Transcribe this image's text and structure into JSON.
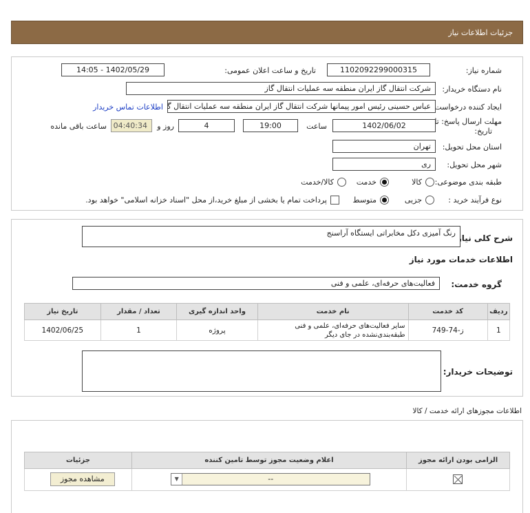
{
  "header": {
    "title": "جزئیات اطلاعات نیاز"
  },
  "form": {
    "need_number_label": "شماره نیاز:",
    "need_number": "1102092299000315",
    "announce_label": "تاریخ و ساعت اعلان عمومی:",
    "announce_value": "1402/05/29 - 14:05",
    "buyer_org_label": "نام دستگاه خریدار:",
    "buyer_org": "شرکت انتقال گاز ایران منطقه سه عملیات انتقال گاز",
    "requester_label": "ایجاد کننده درخواست:",
    "requester": "عباس حسینی رئیس امور پیمانها شرکت انتقال گاز ایران منطقه سه عملیات انتقال گاز",
    "contact_link": "اطلاعات تماس خریدار",
    "deadline_label_1": "مهلت ارسال پاسخ: تا",
    "deadline_label_2": "تاریخ:",
    "deadline_date": "1402/06/02",
    "time_label": "ساعت",
    "deadline_time": "19:00",
    "days_value": "4",
    "days_label": "روز و",
    "remaining_time": "04:40:34",
    "remaining_label": "ساعت باقی مانده",
    "province_label": "استان محل تحویل:",
    "province": "تهران",
    "city_label": "شهر محل تحویل:",
    "city": "ری",
    "category_label": "طبقه بندی موضوعی:",
    "category_options": [
      "کالا",
      "خدمت",
      "کالا/خدمت"
    ],
    "category_selected": "خدمت",
    "process_label": "نوع فرآیند خرید :",
    "process_options": [
      "جزیی",
      "متوسط"
    ],
    "process_selected": "متوسط",
    "payment_note": "پرداخت تمام یا بخشی از مبلغ خرید،از محل \"اسناد خزانه اسلامی\" خواهد بود."
  },
  "summary": {
    "label": "شرح کلی نیاز:",
    "value": "رنگ آمیزی دکل مخابراتی ایستگاه آراسنج"
  },
  "services": {
    "title": "اطلاعات خدمات مورد نیاز",
    "group_label": "گروه خدمت:",
    "group_value": "فعالیت‌های حرفه‌ای، علمی و فنی",
    "columns": [
      "ردیف",
      "کد خدمت",
      "نام خدمت",
      "واحد اندازه گیری",
      "تعداد / مقدار",
      "تاریخ نیاز"
    ],
    "rows": [
      {
        "index": "1",
        "code": "ز-74-749",
        "name": "سایر فعالیت‌های حرفه‌ای، علمی و فنی طبقه‌بندی‌نشده در جای دیگر",
        "unit": "پروژه",
        "qty": "1",
        "date": "1402/06/25"
      }
    ],
    "buyer_desc_label": "توضیحات خریدار:"
  },
  "permits": {
    "title": "اطلاعات مجوزهای ارائه خدمت / کالا",
    "columns": [
      "الزامی بودن ارائه مجوز",
      "اعلام وضعیت مجوز توسط تامین کننده",
      "جزئیات"
    ],
    "status_value": "--",
    "view_button": "مشاهده مجوز"
  }
}
